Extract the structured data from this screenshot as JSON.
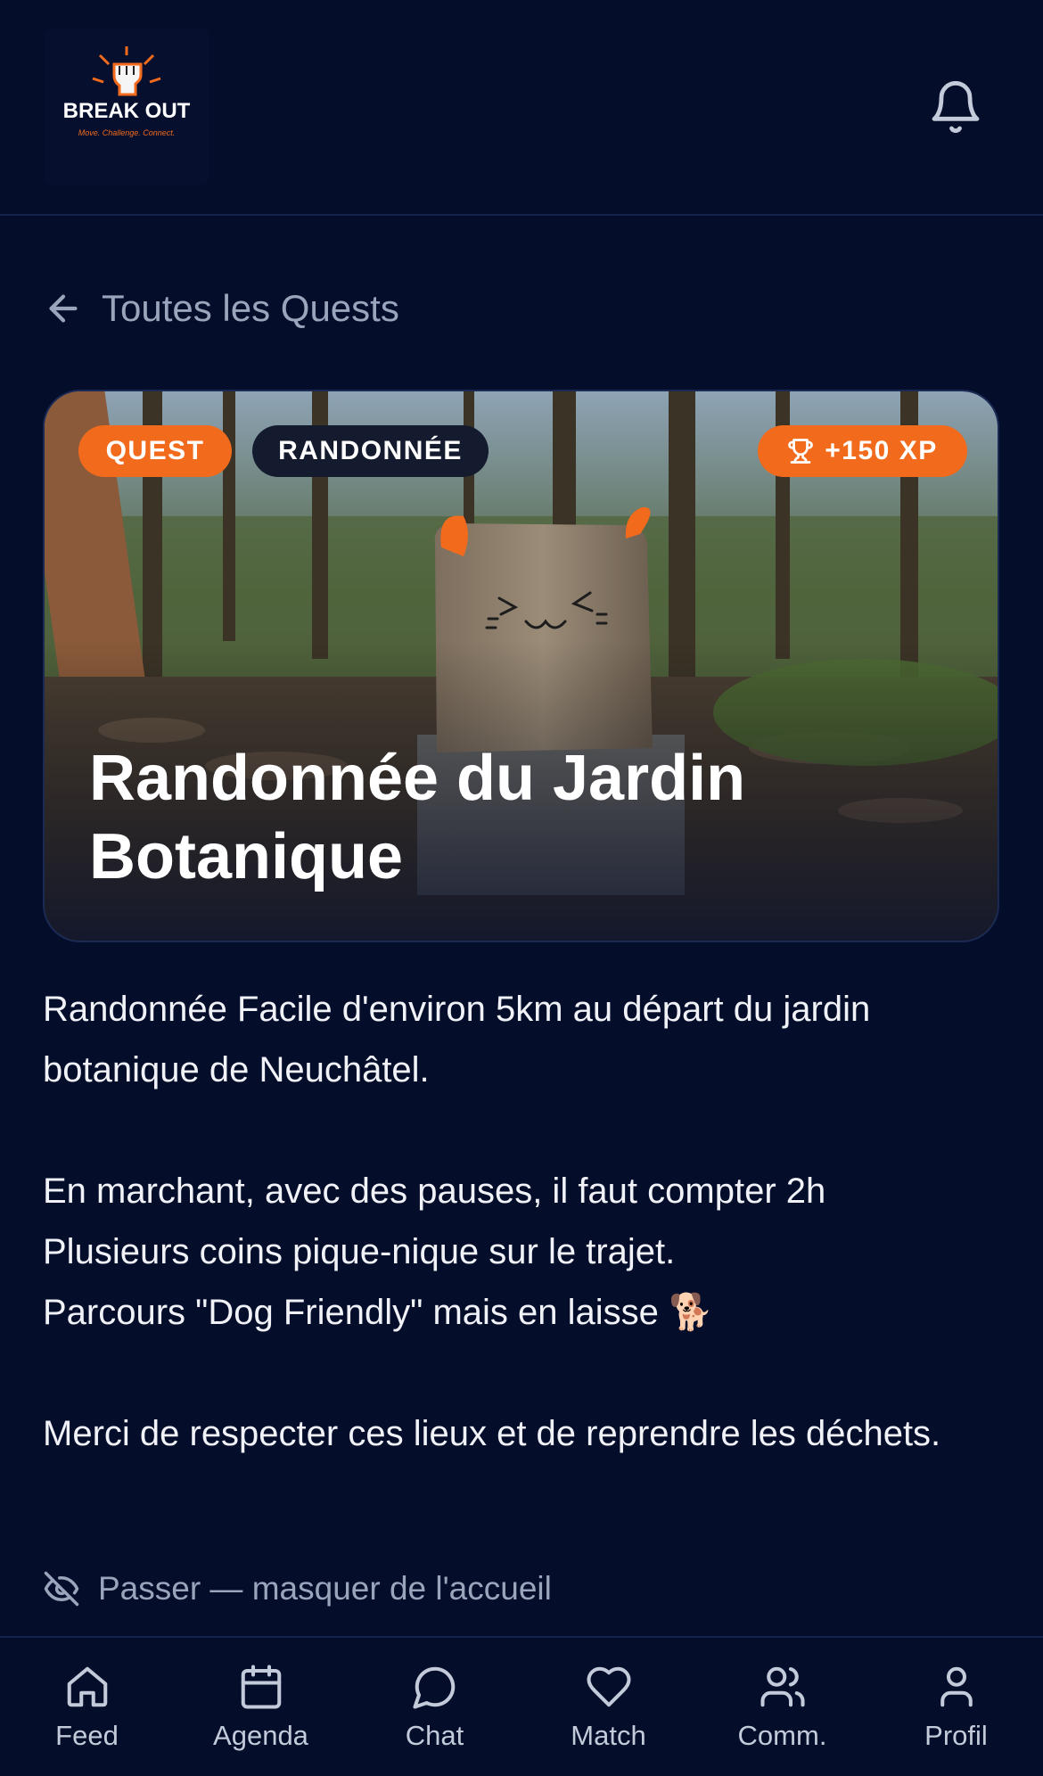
{
  "header": {
    "logo_text": "BREAK OUT",
    "logo_tagline": "Move. Challenge. Connect.",
    "bell_icon": "bell-icon"
  },
  "back_link": {
    "label": "Toutes les Quests",
    "icon": "arrow-left-icon"
  },
  "hero": {
    "badge_type": "QUEST",
    "badge_category": "RANDONNÉE",
    "badge_xp": "+150 XP",
    "xp_icon": "trophy-icon",
    "title": "Randonnée du Jardin Botanique"
  },
  "description": {
    "p1": "Randonnée Facile d'environ 5km au départ du jardin botanique de Neuchâtel.",
    "p2": "En marchant, avec des pauses, il faut compter 2h",
    "p3": "Plusieurs coins pique-nique sur le trajet.",
    "p4": "Parcours \"Dog Friendly\" mais en laisse 🐕",
    "p5": "Merci de respecter ces lieux et de reprendre les déchets."
  },
  "skip": {
    "label": "Passer — masquer de l'accueil",
    "icon": "eye-off-icon"
  },
  "nav": {
    "items": [
      {
        "label": "Feed",
        "icon": "home-icon"
      },
      {
        "label": "Agenda",
        "icon": "calendar-icon"
      },
      {
        "label": "Chat",
        "icon": "chat-bubble-icon"
      },
      {
        "label": "Match",
        "icon": "heart-icon"
      },
      {
        "label": "Comm.",
        "icon": "users-icon"
      },
      {
        "label": "Profil",
        "icon": "user-icon"
      }
    ]
  },
  "colors": {
    "background": "#040d2a",
    "accent": "#f26b1d",
    "muted_text": "#9aa5bc"
  }
}
